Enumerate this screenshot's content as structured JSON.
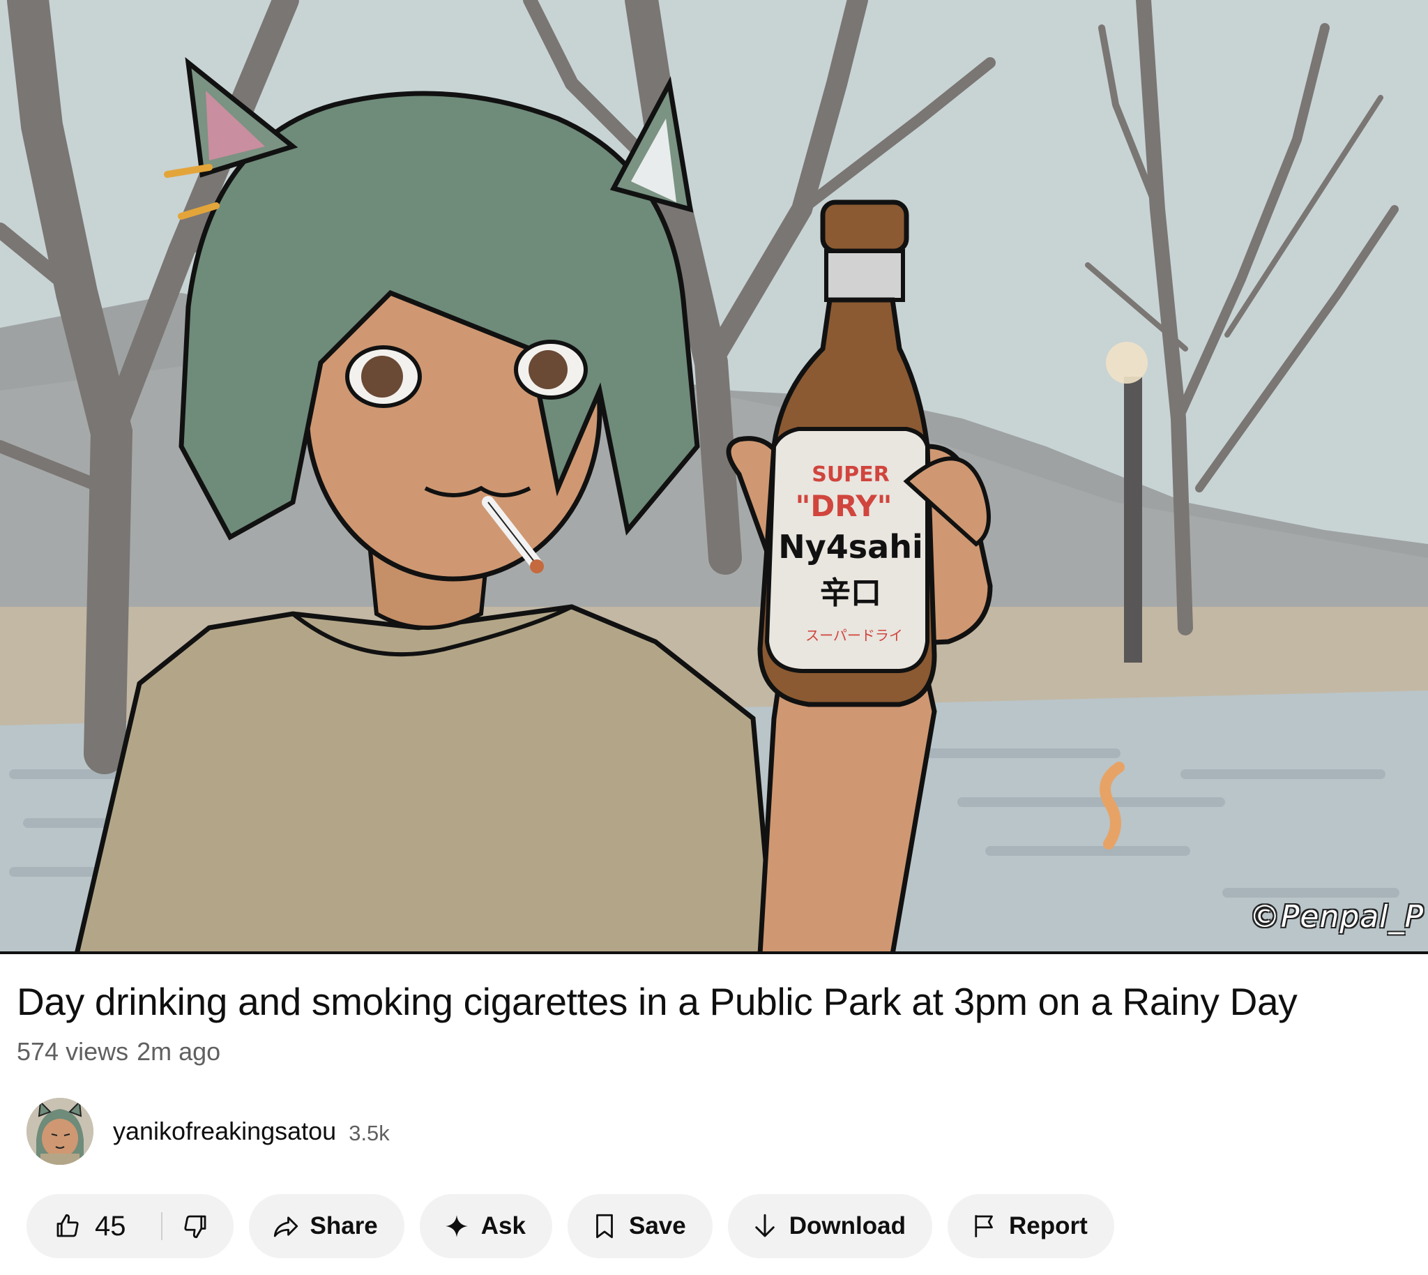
{
  "video": {
    "title": "Day drinking and smoking cigarettes in a Public Park at 3pm on a Rainy Day",
    "views": "574 views",
    "age": "2m ago",
    "watermark": "©Penpal_P",
    "bottle_label": {
      "line1": "SUPER",
      "line2": "\"DRY\"",
      "brand": "Ny4sahi",
      "kanji": "辛口",
      "kana": "スーパードライ"
    }
  },
  "channel": {
    "name": "yanikofreakingsatou",
    "subscribers": "3.5k"
  },
  "actions": {
    "like_count": "45",
    "share": "Share",
    "ask": "Ask",
    "save": "Save",
    "download": "Download",
    "report": "Report"
  },
  "colors": {
    "pill_bg": "#f2f2f2",
    "text_primary": "#0f0f0f",
    "text_secondary": "#606060"
  }
}
